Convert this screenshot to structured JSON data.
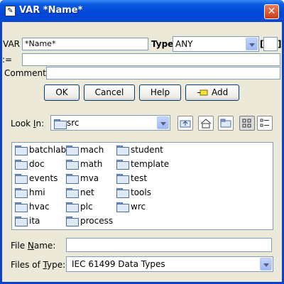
{
  "window": {
    "title": "VAR *Name*"
  },
  "var_row": {
    "var_label": "VAR",
    "name_value": "*Name*",
    "type_label": "Type",
    "type_value": "ANY",
    "open_bracket": "[",
    "close_bracket": "]"
  },
  "init_label": ":=",
  "comment_label": "Comment",
  "buttons": {
    "ok": "OK",
    "cancel": "Cancel",
    "help": "Help",
    "add": "Add"
  },
  "look_in": {
    "label_pre": "Look ",
    "label_ul": "I",
    "label_post": "n:",
    "value": "src"
  },
  "files": [
    "batchlab",
    "doc",
    "events",
    "hmi",
    "hvac",
    "ita",
    "mach",
    "math",
    "mva",
    "net",
    "plc",
    "process",
    "student",
    "template",
    "test",
    "tools",
    "wrc"
  ],
  "file_name": {
    "label_pre": "File ",
    "label_ul": "N",
    "label_post": "ame:",
    "value": ""
  },
  "files_of_type": {
    "label_pre": "Files of ",
    "label_ul": "T",
    "label_post": "ype:",
    "value": "IEC 61499 Data Types"
  },
  "icons": {
    "title": "app-icon",
    "close": "close-icon",
    "add": "add-icon",
    "up_folder": "up-folder-icon",
    "home": "home-icon",
    "new_folder": "new-folder-icon",
    "list_view": "list-view-icon",
    "details_view": "details-view-icon",
    "folder": "folder-icon"
  }
}
